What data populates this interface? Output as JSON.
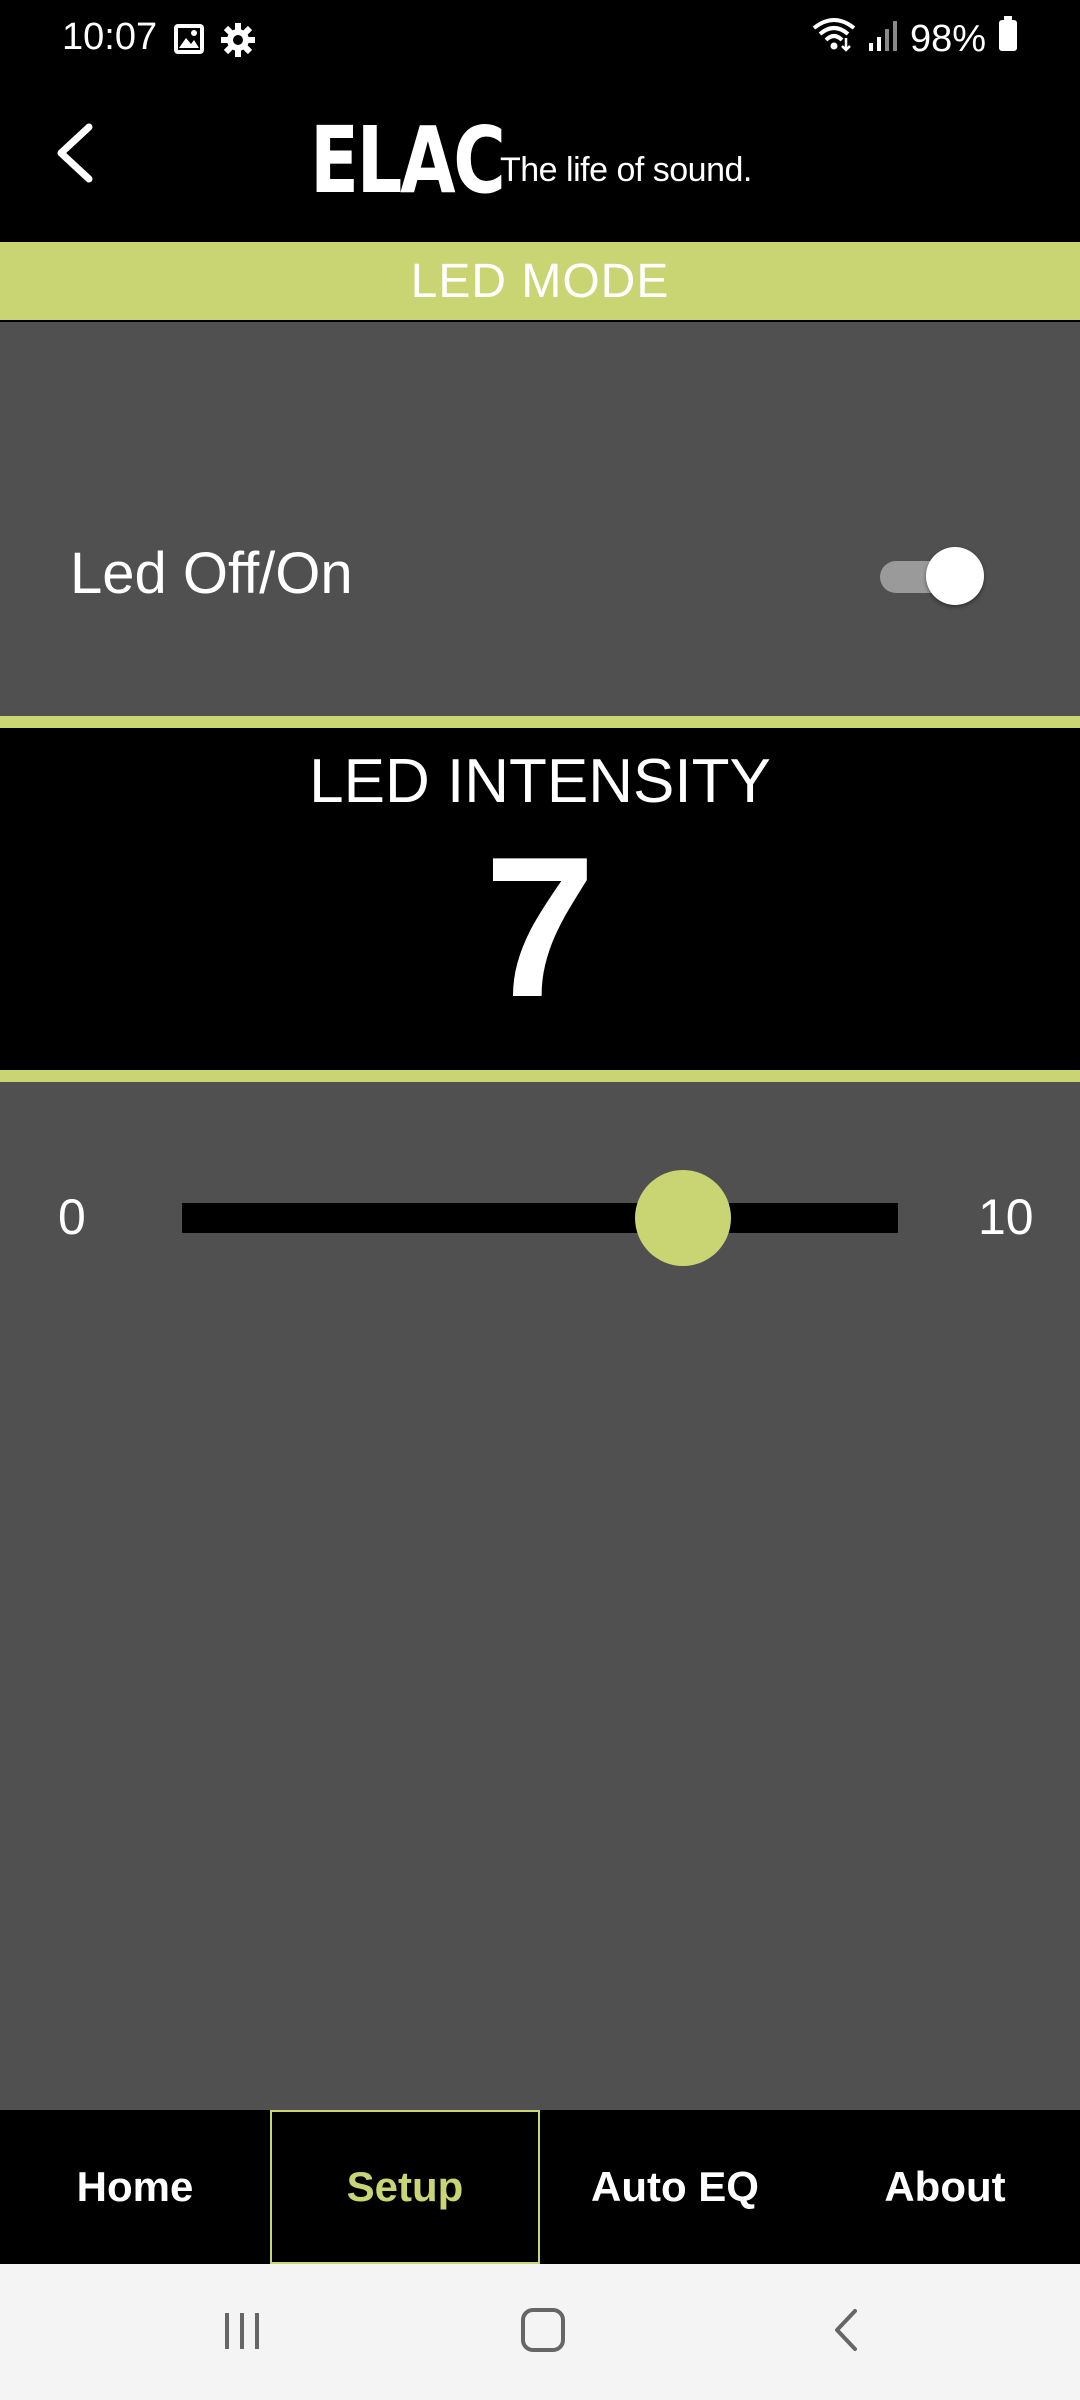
{
  "status_bar": {
    "time": "10:07",
    "battery": "98%",
    "left_icons": [
      "image-icon",
      "gear-icon"
    ],
    "right_icons": [
      "wifi-icon",
      "signal-icon",
      "battery-icon"
    ]
  },
  "header": {
    "brand": "ELAC",
    "tagline": "The life of sound.",
    "back_icon": "chevron-left-icon"
  },
  "led_mode": {
    "title": "LED MODE",
    "toggle_label": "Led Off/On",
    "toggle_on": true
  },
  "intensity": {
    "title": "LED INTENSITY",
    "value": "7",
    "slider_min": "0",
    "slider_max": "10",
    "slider_value": 7
  },
  "bottom_nav": {
    "items": [
      {
        "label": "Home",
        "active": false
      },
      {
        "label": "Setup",
        "active": true
      },
      {
        "label": "Auto EQ",
        "active": false
      },
      {
        "label": "About",
        "active": false
      }
    ]
  },
  "system_nav": {
    "buttons": [
      "recent-apps-icon",
      "home-icon",
      "back-icon"
    ]
  },
  "colors": {
    "accent": "#c9d473",
    "panel": "#505050",
    "background": "#000000",
    "system_nav_bg": "#f4f4f4"
  }
}
